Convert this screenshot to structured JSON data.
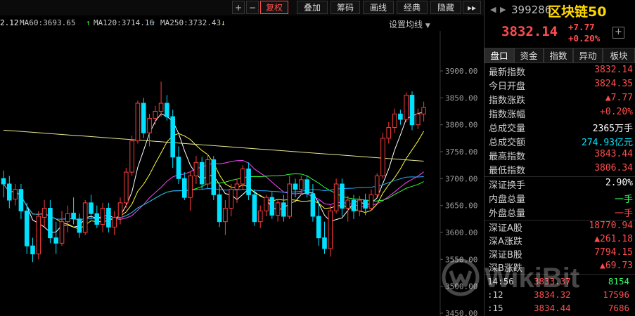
{
  "toolbar": {
    "plus": "+",
    "minus": "−",
    "sep": "|",
    "fuquan": "复权",
    "diejia": "叠加",
    "choumai": "筹码",
    "huaxian": "画线",
    "jingdian": "经典",
    "yincang": "隐藏",
    "more": "▸▸"
  },
  "ma": {
    "ma_partial": "2.12",
    "ma60": "MA60:3693.65",
    "ma120": "MA120:3714.16",
    "ma250": "MA250:3732.43",
    "up_arrow": "↑",
    "down_arrow": "↓",
    "settings": "设置均线"
  },
  "colors": {
    "up": "#ff3b3b",
    "down": "#00e0ff",
    "ma5": "#ffffff",
    "ma10": "#ffff33",
    "ma20": "#ff44ff",
    "ma60": "#33ff33",
    "ma120": "#22aaff",
    "ma250": "#e8e890"
  },
  "header": {
    "nav_left": "◀",
    "nav_right": "▶",
    "code": "399286",
    "name": "区块链50",
    "price": "3832.14",
    "change": "+7.77",
    "change_pct": "+0.20%",
    "add": "+"
  },
  "tabs": [
    "盘口",
    "资金",
    "指数",
    "异动",
    "板块"
  ],
  "quote": [
    {
      "label": "最新指数",
      "value": "3832.14",
      "color": "red"
    },
    {
      "label": "今日开盘",
      "value": "3824.35",
      "color": "red"
    },
    {
      "label": "指数涨跌",
      "value": "▲7.77",
      "color": "red"
    },
    {
      "label": "指数涨幅",
      "value": "+0.20%",
      "color": "red"
    },
    {
      "label": "总成交量",
      "value": "2365万手",
      "color": "white"
    },
    {
      "label": "总成交额",
      "value": "274.93亿元",
      "color": "cyan"
    },
    {
      "label": "最高指数",
      "value": "3843.44",
      "color": "red"
    },
    {
      "label": "最低指数",
      "value": "3806.34",
      "color": "red"
    }
  ],
  "stats1": [
    {
      "label": "深证换手",
      "value": "2.90%",
      "color": "white"
    },
    {
      "label": "内盘总量",
      "value": "一手",
      "color": "green"
    },
    {
      "label": "外盘总量",
      "value": "一手",
      "color": "red"
    }
  ],
  "stats2": [
    {
      "label": "深证A股",
      "value": "18770.94",
      "color": "red"
    },
    {
      "label": "深A涨跌",
      "value": "▲261.18",
      "color": "red"
    },
    {
      "label": "深证B股",
      "value": "7794.15",
      "color": "red"
    },
    {
      "label": "深B涨跌",
      "value": "▲69.73",
      "color": "red"
    }
  ],
  "ticks": [
    {
      "time": "14:56",
      "price": "3833.37",
      "vol": "8154",
      "vol_color": "green"
    },
    {
      "time": ":12",
      "price": "3834.32",
      "vol": "17596",
      "vol_color": "red"
    },
    {
      "time": ":15",
      "price": "3834.44",
      "vol": "7686",
      "vol_color": "red"
    }
  ],
  "watermark": "WikiBit",
  "chart_data": {
    "type": "candlestick",
    "y_ticks": [
      "3900.00",
      "3850.00",
      "3800.00",
      "3750.00",
      "3700.00",
      "3650.00",
      "3600.00",
      "3550.00",
      "3500.00",
      "3450.00"
    ],
    "ylim": [
      3450,
      3900
    ],
    "candles": [
      [
        3700,
        3715,
        3665,
        3690
      ],
      [
        3690,
        3705,
        3645,
        3660
      ],
      [
        3662,
        3690,
        3650,
        3680
      ],
      [
        3680,
        3690,
        3625,
        3640
      ],
      [
        3640,
        3655,
        3560,
        3575
      ],
      [
        3575,
        3590,
        3545,
        3560
      ],
      [
        3560,
        3640,
        3550,
        3630
      ],
      [
        3628,
        3660,
        3610,
        3645
      ],
      [
        3645,
        3660,
        3580,
        3590
      ],
      [
        3590,
        3620,
        3560,
        3580
      ],
      [
        3580,
        3640,
        3575,
        3620
      ],
      [
        3620,
        3650,
        3600,
        3635
      ],
      [
        3636,
        3665,
        3615,
        3625
      ],
      [
        3625,
        3635,
        3590,
        3600
      ],
      [
        3600,
        3660,
        3595,
        3655
      ],
      [
        3655,
        3670,
        3625,
        3635
      ],
      [
        3635,
        3650,
        3608,
        3615
      ],
      [
        3615,
        3655,
        3600,
        3645
      ],
      [
        3645,
        3655,
        3600,
        3610
      ],
      [
        3610,
        3640,
        3595,
        3628
      ],
      [
        3628,
        3665,
        3615,
        3655
      ],
      [
        3655,
        3720,
        3645,
        3712
      ],
      [
        3712,
        3780,
        3705,
        3770
      ],
      [
        3770,
        3845,
        3765,
        3840
      ],
      [
        3840,
        3850,
        3775,
        3785
      ],
      [
        3785,
        3820,
        3760,
        3812
      ],
      [
        3812,
        3835,
        3800,
        3825
      ],
      [
        3825,
        3880,
        3815,
        3840
      ],
      [
        3840,
        3855,
        3808,
        3815
      ],
      [
        3815,
        3828,
        3720,
        3740
      ],
      [
        3740,
        3760,
        3690,
        3700
      ],
      [
        3700,
        3712,
        3660,
        3665
      ],
      [
        3665,
        3712,
        3640,
        3705
      ],
      [
        3705,
        3742,
        3690,
        3730
      ],
      [
        3730,
        3740,
        3680,
        3690
      ],
      [
        3690,
        3745,
        3680,
        3735
      ],
      [
        3735,
        3742,
        3660,
        3670
      ],
      [
        3670,
        3690,
        3610,
        3620
      ],
      [
        3620,
        3660,
        3595,
        3645
      ],
      [
        3645,
        3690,
        3630,
        3680
      ],
      [
        3680,
        3700,
        3655,
        3690
      ],
      [
        3690,
        3725,
        3680,
        3718
      ],
      [
        3718,
        3730,
        3660,
        3670
      ],
      [
        3670,
        3680,
        3612,
        3620
      ],
      [
        3620,
        3650,
        3608,
        3640
      ],
      [
        3640,
        3670,
        3630,
        3665
      ],
      [
        3665,
        3675,
        3625,
        3632
      ],
      [
        3632,
        3660,
        3620,
        3655
      ],
      [
        3655,
        3670,
        3620,
        3630
      ],
      [
        3630,
        3705,
        3625,
        3690
      ],
      [
        3690,
        3700,
        3665,
        3680
      ],
      [
        3680,
        3705,
        3670,
        3698
      ],
      [
        3698,
        3705,
        3665,
        3672
      ],
      [
        3672,
        3690,
        3620,
        3630
      ],
      [
        3630,
        3660,
        3575,
        3590
      ],
      [
        3590,
        3620,
        3560,
        3570
      ],
      [
        3570,
        3650,
        3555,
        3640
      ],
      [
        3640,
        3700,
        3635,
        3690
      ],
      [
        3690,
        3700,
        3630,
        3645
      ],
      [
        3645,
        3668,
        3620,
        3660
      ],
      [
        3660,
        3670,
        3625,
        3640
      ],
      [
        3640,
        3668,
        3630,
        3660
      ],
      [
        3660,
        3672,
        3632,
        3645
      ],
      [
        3645,
        3680,
        3640,
        3670
      ],
      [
        3670,
        3710,
        3665,
        3705
      ],
      [
        3705,
        3785,
        3700,
        3775
      ],
      [
        3775,
        3805,
        3765,
        3795
      ],
      [
        3795,
        3830,
        3785,
        3820
      ],
      [
        3820,
        3828,
        3800,
        3810
      ],
      [
        3810,
        3860,
        3805,
        3855
      ],
      [
        3855,
        3862,
        3790,
        3800
      ],
      [
        3800,
        3830,
        3792,
        3820
      ],
      [
        3820,
        3843,
        3806,
        3832
      ]
    ]
  }
}
